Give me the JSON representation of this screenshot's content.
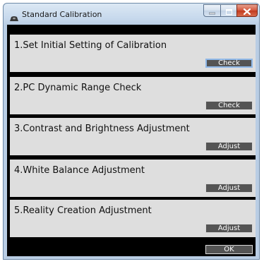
{
  "window": {
    "title": "Standard Calibration"
  },
  "sections": [
    {
      "label": "1.Set Initial Setting of Calibration",
      "button": "Check"
    },
    {
      "label": "2.PC Dynamic Range Check",
      "button": "Check"
    },
    {
      "label": "3.Contrast and Brightness Adjustment",
      "button": "Adjust"
    },
    {
      "label": "4.White Balance Adjustment",
      "button": "Adjust"
    },
    {
      "label": "5.Reality Creation Adjustment",
      "button": "Adjust"
    }
  ],
  "footer": {
    "ok_label": "OK"
  },
  "colors": {
    "client_background": "#000000",
    "section_background": "#dedede",
    "button_background": "#545454",
    "focused_button_border": "#8fb8e8",
    "close_button": "#c13a1e"
  },
  "icons": {
    "title_icon": "projector-icon",
    "minimize": "minimize-icon",
    "maximize": "maximize-icon",
    "close": "close-icon"
  }
}
